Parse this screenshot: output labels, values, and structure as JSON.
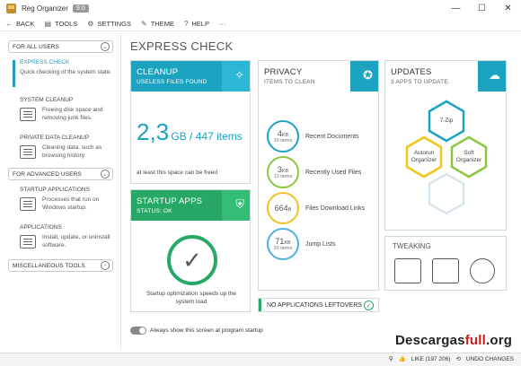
{
  "window": {
    "title": "Reg Organizer",
    "version": "9.0",
    "controls": [
      "—",
      "☐",
      "✕"
    ]
  },
  "toolbar": {
    "back": "BACK",
    "tools": "TOOLS",
    "settings": "SETTINGS",
    "theme": "THEME",
    "help": "HELP",
    "more": "···"
  },
  "sidebar": {
    "for_all_users": "FOR ALL USERS",
    "for_advanced_users": "FOR ADVANCED USERS",
    "miscellaneous_tools": "MISCELLANEOUS TOOLS",
    "items": [
      {
        "title": "EXPRESS CHECK",
        "desc": "Quick checking of the system state."
      },
      {
        "title": "SYSTEM CLEANUP",
        "desc": "Freeing disk space and removing junk files."
      },
      {
        "title": "PRIVATE DATA CLEANUP",
        "desc": "Cleaning data, such as browsing history."
      },
      {
        "title": "STARTUP APPLICATIONS",
        "desc": "Processes that run on Windows startup."
      },
      {
        "title": "APPLICATIONS",
        "desc": "Install, update, or uninstall software."
      }
    ]
  },
  "main": {
    "title": "EXPRESS CHECK"
  },
  "cleanup": {
    "title": "CLEANUP",
    "subtitle": "USELESS FILES FOUND",
    "value": "2,3",
    "unit": "GB / 447 items",
    "footer": "at least this space can be freed"
  },
  "startup": {
    "title": "STARTUP APPS",
    "status": "STATUS: OK",
    "message": "Startup optimization speeds up the system load"
  },
  "privacy": {
    "title": "PRIVACY",
    "subtitle": "ITEMS TO CLEAN",
    "rows": [
      {
        "value": "4",
        "unit": "KB",
        "count": "15 items",
        "label": "Recent Documents",
        "color": "#1ba3c0"
      },
      {
        "value": "3",
        "unit": "KB",
        "count": "13 items",
        "label": "Recently Used Files",
        "color": "#8cc63f"
      },
      {
        "value": "664",
        "unit": "B",
        "count": "",
        "label": "Files Download Links",
        "color": "#f2c31b"
      },
      {
        "value": "71",
        "unit": "KB",
        "count": "20 items",
        "label": "Jump Lists",
        "color": "#4fb3d9"
      }
    ]
  },
  "updates": {
    "title": "UPDATES",
    "subtitle": "3 APPS TO UPDATE",
    "apps": [
      "7-Zip",
      "Autorun Organizer",
      "Soft Organizer"
    ]
  },
  "tweaking": {
    "title": "TWEAKING"
  },
  "leftovers": {
    "label": "NO APPLICATIONS LEFTOVERS"
  },
  "footer": {
    "show_toggle_label": "Always show this screen at program startup",
    "like_label": "LIKE (197 206)",
    "undo_label": "UNDO CHANGES",
    "watermark_dark": "Descargas",
    "watermark_red": "full",
    "watermark_tail": ".org"
  },
  "colors": {
    "teal": "#1ba3c0",
    "green": "#27a867"
  }
}
